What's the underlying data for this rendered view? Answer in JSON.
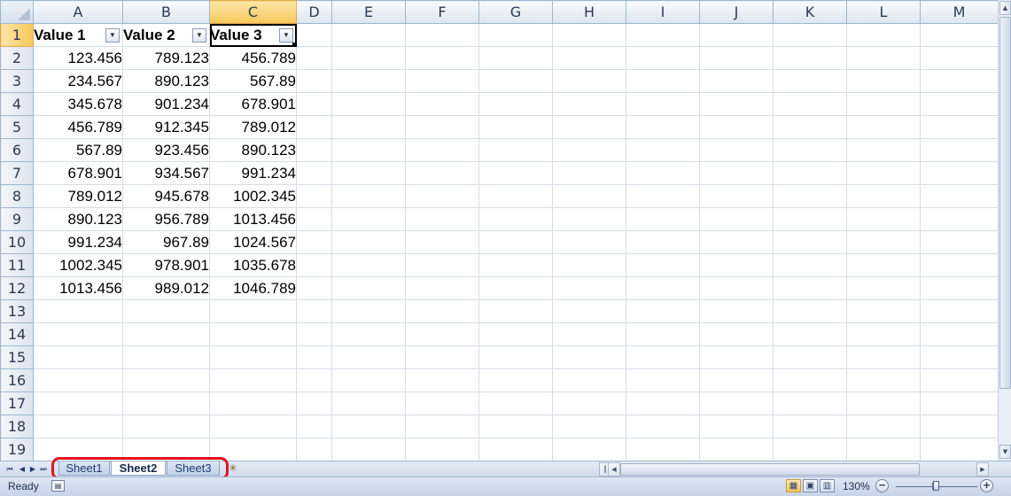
{
  "columns": [
    "A",
    "B",
    "C",
    "D",
    "E",
    "F",
    "G",
    "H",
    "I",
    "J",
    "K",
    "L",
    "M"
  ],
  "rows": [
    "1",
    "2",
    "3",
    "4",
    "5",
    "6",
    "7",
    "8",
    "9",
    "10",
    "11",
    "12",
    "13",
    "14",
    "15",
    "16",
    "17",
    "18",
    "19"
  ],
  "table": {
    "headers": [
      "Value 1",
      "Value 2",
      "Value 3"
    ],
    "data": [
      [
        "123.456",
        "789.123",
        "456.789"
      ],
      [
        "234.567",
        "890.123",
        "567.89"
      ],
      [
        "345.678",
        "901.234",
        "678.901"
      ],
      [
        "456.789",
        "912.345",
        "789.012"
      ],
      [
        "567.89",
        "923.456",
        "890.123"
      ],
      [
        "678.901",
        "934.567",
        "991.234"
      ],
      [
        "789.012",
        "945.678",
        "1002.345"
      ],
      [
        "890.123",
        "956.789",
        "1013.456"
      ],
      [
        "991.234",
        "967.89",
        "1024.567"
      ],
      [
        "1002.345",
        "978.901",
        "1035.678"
      ],
      [
        "1013.456",
        "989.012",
        "1046.789"
      ]
    ]
  },
  "selection": {
    "column": "C",
    "row": "1"
  },
  "sheet_tabs": [
    {
      "label": "Sheet1",
      "active": false
    },
    {
      "label": "Sheet2",
      "active": true
    },
    {
      "label": "Sheet3",
      "active": false
    }
  ],
  "status": {
    "text": "Ready",
    "zoom": "130%"
  },
  "colors": {
    "highlight": "#e0141e",
    "selected_header": "#f7c75a"
  }
}
